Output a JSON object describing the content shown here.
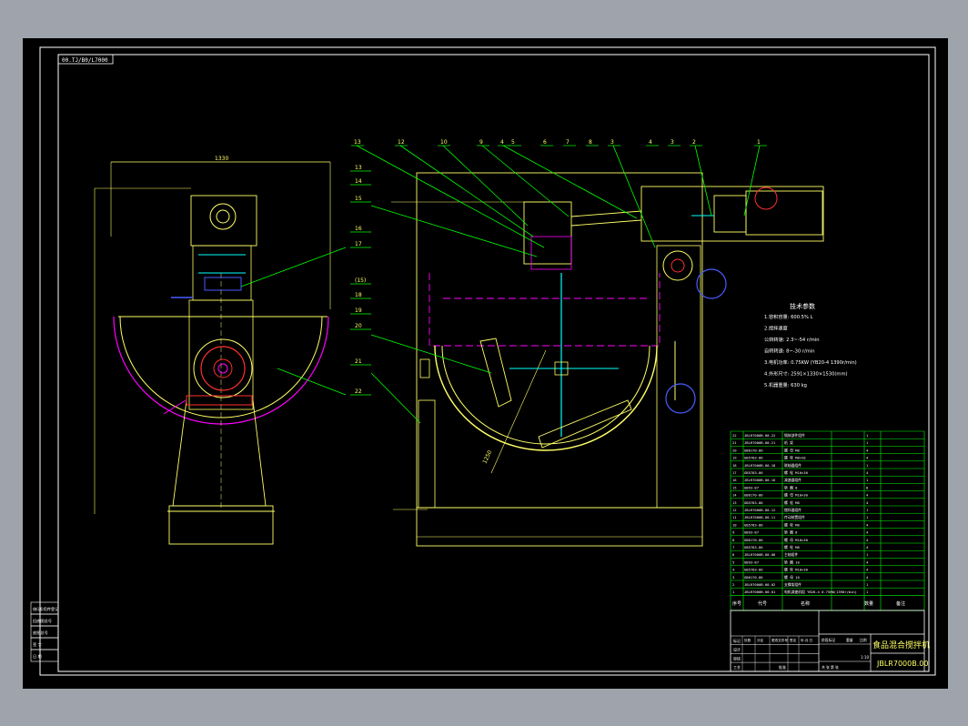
{
  "drawing": {
    "code_stamp": "00.TJ/B0/L7000",
    "overall_width_dim": "1330",
    "bowl_dim": "1250",
    "balloons_top": [
      "13",
      "12",
      "10",
      "9",
      "4",
      "5",
      "6",
      "7",
      "8",
      "3",
      "4",
      "3",
      "2",
      "1"
    ],
    "balloons_left": [
      "13",
      "14",
      "15",
      "16",
      "17",
      "(15)",
      "18",
      "19",
      "20",
      "21",
      "22"
    ]
  },
  "tech_spec": {
    "title": "技术参数",
    "lines": [
      "1.容积容量:      600.5%  L",
      "2.搅拌速度",
      "   公转转速:    2.3~-54  r/min",
      "   自转转速:     8~-30  r/min",
      "3.电机功率:  0.75KW (YB20-4 1390r/min)",
      "4.外形尺寸:  2591×1330×1530(mm)",
      "5.机器重量:     630  kg"
    ]
  },
  "bom": {
    "rows": [
      {
        "no": "22",
        "code": "JBLR7000B.00-22",
        "name": "锅体部件组件",
        "qty": "1"
      },
      {
        "no": "21",
        "code": "JBLR7000B.00-21",
        "name": "机  架",
        "qty": "1"
      },
      {
        "no": "20",
        "code": "GB6170-86",
        "name": "螺  母  M8",
        "qty": "4"
      },
      {
        "no": "19",
        "code": "GB5783-86",
        "name": "螺  栓  M8×20",
        "qty": "4"
      },
      {
        "no": "18",
        "code": "JBLR7000B.00-18",
        "name": "联轴器组件",
        "qty": "1"
      },
      {
        "no": "17",
        "code": "GB5783-86",
        "name": "螺  栓  M10×30",
        "qty": "4"
      },
      {
        "no": "16",
        "code": "JBLR7000B.00-16",
        "name": "减速器组件",
        "qty": "1"
      },
      {
        "no": "15",
        "code": "GB93-87",
        "name": "垫  圈  8",
        "qty": "8"
      },
      {
        "no": "14",
        "code": "GB6170-86",
        "name": "螺  母  M10×30",
        "qty": "4"
      },
      {
        "no": "13",
        "code": "GB5783-86",
        "name": "螺  栓  M8",
        "qty": "4"
      },
      {
        "no": "12",
        "code": "JBLR7000B.00-12",
        "name": "搅拌器组件",
        "qty": "1"
      },
      {
        "no": "11",
        "code": "JBLR7000B.00-11",
        "name": "传动装置组件",
        "qty": "1"
      },
      {
        "no": "10",
        "code": "GB5783-86",
        "name": "螺  栓  M8",
        "qty": "4"
      },
      {
        "no": "9",
        "code": "GB93-87",
        "name": "垫  圈  8",
        "qty": "4"
      },
      {
        "no": "8",
        "code": "GB6170-86",
        "name": "螺  母  M10×30",
        "qty": "4"
      },
      {
        "no": "7",
        "code": "GB5783-86",
        "name": "螺  栓  M8",
        "qty": "4"
      },
      {
        "no": "6",
        "code": "JBLR7000B.00-06",
        "name": "主轴组件",
        "qty": "1"
      },
      {
        "no": "5",
        "code": "GB93-87",
        "name": "垫  圈  10",
        "qty": "4"
      },
      {
        "no": "4",
        "code": "GB5783-86",
        "name": "螺  栓  M10×30",
        "qty": "4"
      },
      {
        "no": "3",
        "code": "GB6170-86",
        "name": "螺  母  10",
        "qty": "4"
      },
      {
        "no": "2",
        "code": "JBLR7000B.00-02",
        "name": "支撑架组件",
        "qty": "1"
      },
      {
        "no": "1",
        "code": "JBLR7000B.00-01",
        "name": "电机减速机组 YB20-4 0.75KW(1390r/min)",
        "qty": "1"
      }
    ],
    "header": {
      "no": "序号",
      "code": "代号",
      "name": "名称",
      "qty": "数量",
      "note": "备注"
    }
  },
  "title_block": {
    "product_name": "食品混合搅拌机",
    "drawing_no": "JBLR7000B.00",
    "scale": "1:10",
    "rows": [
      "标记",
      "设计",
      "审核",
      "工艺"
    ],
    "cols": [
      "处数",
      "分区",
      "更改文件号",
      "签名",
      "年.月.日"
    ],
    "stage_labels": [
      "阶段标记",
      "重量",
      "比例"
    ],
    "sheet_text": "共    张  第    张",
    "approve": "批准"
  },
  "left_strip": [
    "借(通)用件登记",
    "旧底图总号",
    "底图总号",
    "签  字",
    "日  期"
  ],
  "colors": {
    "background": "#000000",
    "frame": "#ffffff",
    "yellow": "#ffff66",
    "green": "#00ff00",
    "magenta": "#ff00ff",
    "blue": "#4a5cff",
    "cyan": "#00ffff",
    "red": "#ff3030"
  }
}
